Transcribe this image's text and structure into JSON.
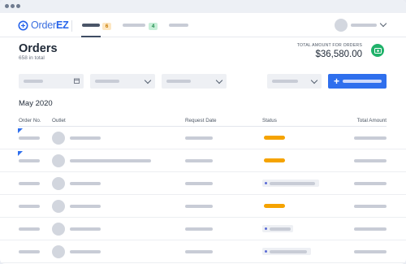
{
  "app": {
    "logo_text": "Order",
    "logo_text_bold": "EZ"
  },
  "nav": {
    "badge_1": "6",
    "badge_2": "4"
  },
  "header": {
    "title": "Orders",
    "subtitle": "658 in total",
    "total_label": "TOTAL AMOUNT FOR ORDERS",
    "total_value": "$36,580.00"
  },
  "section": {
    "month": "May 2020"
  },
  "table": {
    "columns": {
      "order_no": "Order No.",
      "outlet": "Outlet",
      "request_date": "Request Date",
      "status": "Status",
      "total_amount": "Total Amount"
    },
    "rows": [
      {
        "flagged": true,
        "status": "orange"
      },
      {
        "flagged": true,
        "status": "orange"
      },
      {
        "flagged": false,
        "status": "pill"
      },
      {
        "flagged": false,
        "status": "orange"
      },
      {
        "flagged": false,
        "status": "pill"
      },
      {
        "flagged": false,
        "status": "pill"
      }
    ]
  },
  "colors": {
    "accent": "#2f6fed",
    "cash": "#20b26a",
    "status_pending": "#f5a300"
  },
  "icons": [
    "calendar-icon",
    "chevron-down-icon",
    "plus-icon",
    "cash-icon",
    "logo-icon"
  ]
}
